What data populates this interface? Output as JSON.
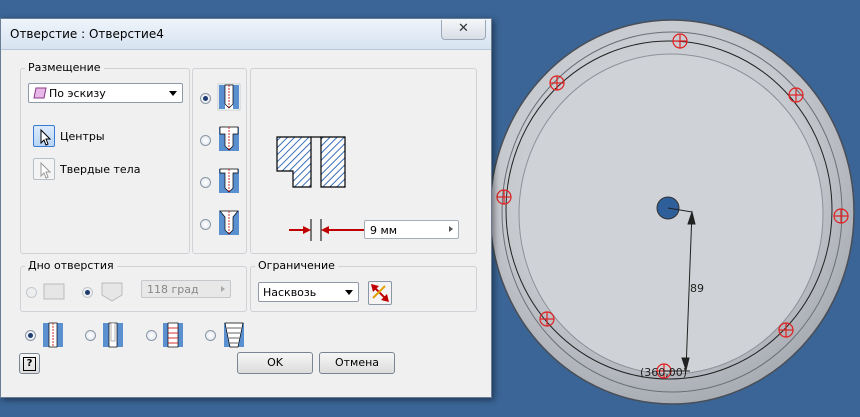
{
  "dialog": {
    "title": "Отверстие : Отверстие4",
    "close_glyph": "✕"
  },
  "placement": {
    "group_title": "Размещение",
    "mode": "По эскизу",
    "centers_label": "Центры",
    "solids_label": "Твердые тела"
  },
  "preview": {
    "diameter_value": "9 мм"
  },
  "hole_bottom": {
    "group_title": "Дно отверстия",
    "angle_value": "118 град"
  },
  "termination": {
    "group_title": "Ограничение",
    "mode": "Насквозь"
  },
  "footer": {
    "help_glyph": "?",
    "ok_label": "OK",
    "cancel_label": "Отмена"
  },
  "model": {
    "dim_vertical": "89",
    "dim_bottom": "(360,00)"
  },
  "colors": {
    "background": "#3a6596",
    "marker": "#e02020",
    "accent": "#c00000"
  }
}
